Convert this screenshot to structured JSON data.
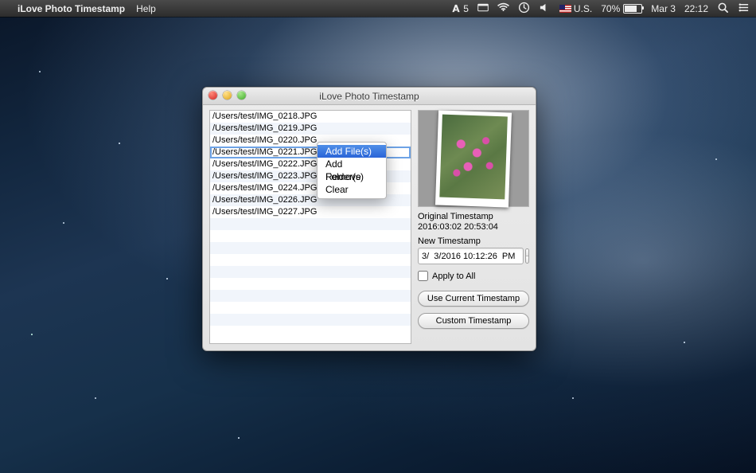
{
  "menubar": {
    "app_name": "iLove Photo Timestamp",
    "menus": [
      "Help"
    ],
    "ai_badge": "5",
    "input_label": "U.S.",
    "battery_pct": "70%",
    "date": "Mar 3",
    "time": "22:12"
  },
  "window": {
    "title": "iLove Photo Timestamp"
  },
  "files": [
    "/Users/test/IMG_0218.JPG",
    "/Users/test/IMG_0219.JPG",
    "/Users/test/IMG_0220.JPG",
    "/Users/test/IMG_0221.JPG",
    "/Users/test/IMG_0222.JPG",
    "/Users/test/IMG_0223.JPG",
    "/Users/test/IMG_0224.JPG",
    "/Users/test/IMG_0226.JPG",
    "/Users/test/IMG_0227.JPG"
  ],
  "selected_index": 3,
  "context_menu": {
    "items": [
      "Add File(s)",
      "Add Folder(s)",
      "Remove",
      "Clear"
    ],
    "highlighted_index": 0
  },
  "panel": {
    "orig_label": "Original Timestamp",
    "orig_value": "2016:03:02 20:53:04",
    "new_label": "New Timestamp",
    "new_value": "3/  3/2016 10:12:26  PM",
    "apply_all": "Apply to All",
    "use_current": "Use Current Timestamp",
    "custom": "Custom Timestamp"
  }
}
